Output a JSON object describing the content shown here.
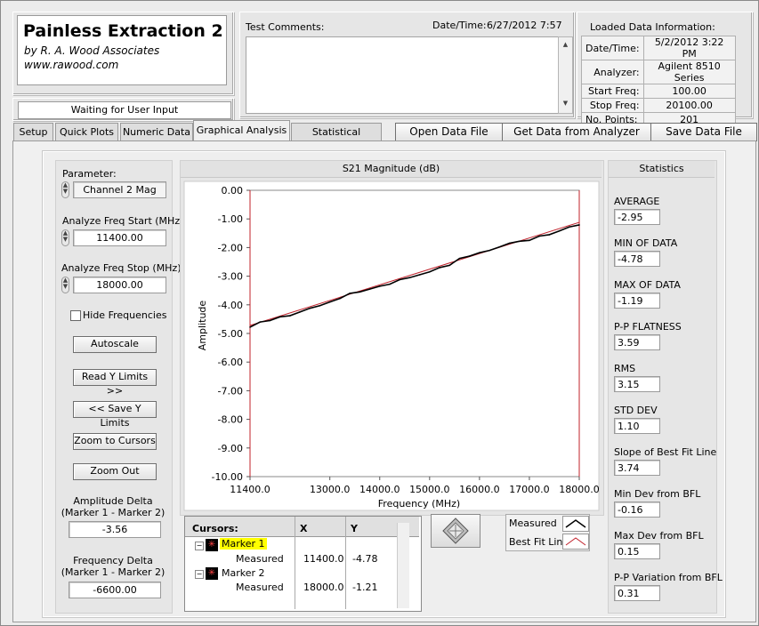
{
  "app": {
    "title": "Painless Extraction 2",
    "author": "by R. A. Wood Associates",
    "website": "www.rawood.com",
    "status": "Waiting for User Input"
  },
  "header": {
    "test_comments_label": "Test Comments:",
    "datetime_label": "Date/Time:",
    "datetime_value": "6/27/2012  7:57",
    "loaded_title": "Loaded Data Information:",
    "loaded": [
      {
        "label": "Date/Time:",
        "value": "5/2/2012 3:22 PM"
      },
      {
        "label": "Analyzer:",
        "value": "Agilent 8510 Series"
      },
      {
        "label": "Start Freq:",
        "value": "100.00"
      },
      {
        "label": "Stop Freq:",
        "value": "20100.00"
      },
      {
        "label": "No. Points:",
        "value": "201"
      }
    ]
  },
  "tabs": [
    "Setup",
    "Quick Plots",
    "Numeric Data",
    "Graphical Analysis",
    "Statistical Analysis"
  ],
  "actions": [
    "Open Data File",
    "Get Data from Analyzer",
    "Save Data File"
  ],
  "left": {
    "parameter_label": "Parameter:",
    "parameter_value": "Channel 2 Mag",
    "start_label": "Analyze Freq Start (MHz)",
    "start_value": "11400.00",
    "stop_label": "Analyze Freq Stop (MHz)",
    "stop_value": "18000.00",
    "hide_label": "Hide Frequencies",
    "buttons": [
      "Autoscale",
      "Read Y Limits >>",
      "<< Save Y Limits",
      "Zoom to Cursors",
      "Zoom Out"
    ],
    "amp_delta_label1": "Amplitude Delta",
    "amp_delta_label2": "(Marker 1 - Marker 2)",
    "amp_delta_value": "-3.56",
    "freq_delta_label1": "Frequency Delta",
    "freq_delta_label2": "(Marker 1 - Marker 2)",
    "freq_delta_value": "-6600.00"
  },
  "cursors": {
    "header": [
      "Cursors:",
      "X",
      "Y"
    ],
    "marker1": "Marker 1",
    "marker2": "Marker 2",
    "sub_label": "Measured",
    "m1_x": "11400.0",
    "m1_y": "-4.78",
    "m2_x": "18000.0",
    "m2_y": "-1.21"
  },
  "legend": {
    "measured": "Measured",
    "bestfit": "Best Fit Line"
  },
  "statistics": {
    "title": "Statistics",
    "items": [
      {
        "label": "AVERAGE",
        "value": "-2.95"
      },
      {
        "label": "MIN OF DATA",
        "value": "-4.78"
      },
      {
        "label": "MAX OF DATA",
        "value": "-1.19"
      },
      {
        "label": "P-P FLATNESS",
        "value": "3.59"
      },
      {
        "label": "RMS",
        "value": "3.15"
      },
      {
        "label": "STD DEV",
        "value": "1.10"
      },
      {
        "label": "Slope of Best Fit Line",
        "value": "3.74"
      },
      {
        "label": "Min Dev from BFL",
        "value": "-0.16"
      },
      {
        "label": "Max Dev from BFL",
        "value": "0.15"
      },
      {
        "label": "P-P Variation from BFL",
        "value": "0.31"
      }
    ]
  },
  "colors": {
    "measured": "#000000",
    "bestfit": "#c0202a",
    "marker_highlight": "#ffff00"
  },
  "chart_data": {
    "type": "line",
    "title": "S21 Magnitude (dB)",
    "xlabel": "Frequency (MHz)",
    "ylabel": "Amplitude",
    "xlim": [
      11400,
      18000
    ],
    "ylim": [
      -10,
      0
    ],
    "x_ticks": [
      "11400.0",
      "13000.0",
      "14000.0",
      "15000.0",
      "16000.0",
      "17000.0",
      "18000.0"
    ],
    "y_ticks": [
      "0.00",
      "-1.00",
      "-2.00",
      "-3.00",
      "-4.00",
      "-5.00",
      "-6.00",
      "-7.00",
      "-8.00",
      "-9.00",
      "-10.00"
    ],
    "series": [
      {
        "name": "Measured",
        "x": [
          11400,
          11600,
          11800,
          12000,
          12200,
          12400,
          12600,
          12800,
          13000,
          13200,
          13400,
          13600,
          13800,
          14000,
          14200,
          14400,
          14600,
          14800,
          15000,
          15200,
          15400,
          15600,
          15800,
          16000,
          16200,
          16400,
          16600,
          16800,
          17000,
          17200,
          17400,
          17600,
          17800,
          18000
        ],
        "y": [
          -4.78,
          -4.6,
          -4.55,
          -4.42,
          -4.38,
          -4.25,
          -4.12,
          -4.03,
          -3.9,
          -3.78,
          -3.6,
          -3.55,
          -3.45,
          -3.35,
          -3.28,
          -3.12,
          -3.05,
          -2.95,
          -2.85,
          -2.7,
          -2.62,
          -2.38,
          -2.3,
          -2.18,
          -2.1,
          -1.98,
          -1.85,
          -1.78,
          -1.75,
          -1.6,
          -1.55,
          -1.42,
          -1.28,
          -1.21
        ]
      },
      {
        "name": "Best Fit Line",
        "x": [
          11400,
          18000
        ],
        "y": [
          -4.72,
          -1.12
        ]
      }
    ]
  }
}
